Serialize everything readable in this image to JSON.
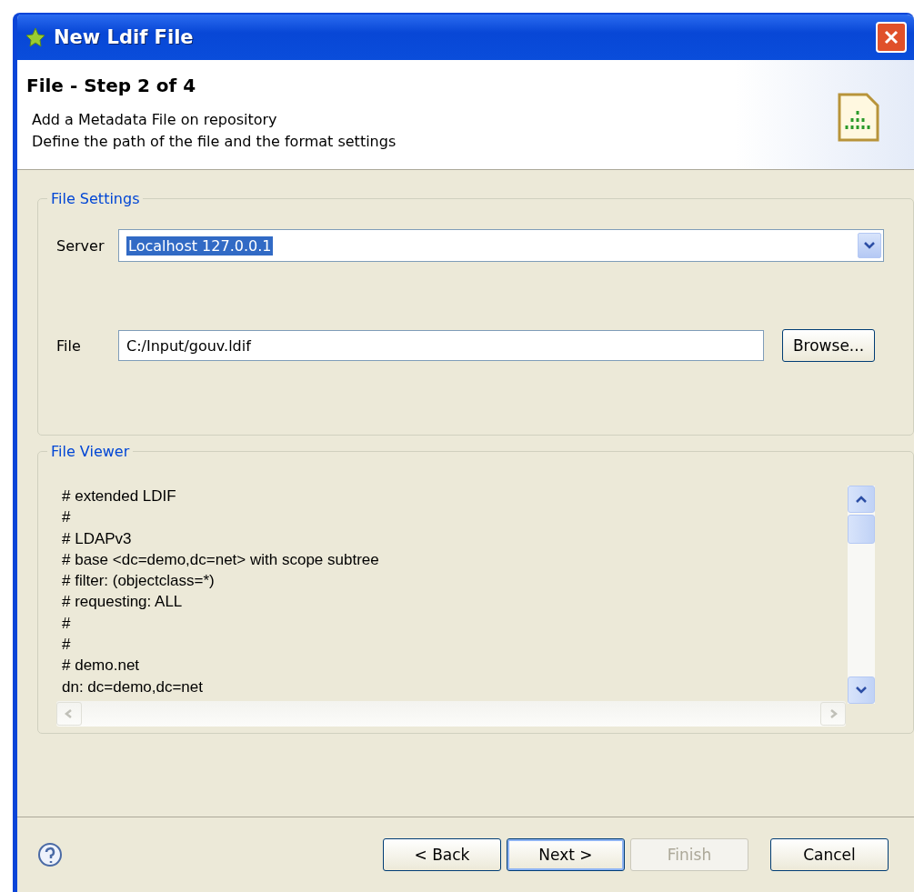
{
  "window": {
    "title": "New Ldif File"
  },
  "header": {
    "title": "File - Step 2 of 4",
    "lines": [
      "Add a Metadata File on repository",
      "Define the path of the file and the format settings"
    ]
  },
  "file_settings": {
    "legend": "File Settings",
    "server_label": "Server",
    "server_value": "Localhost 127.0.0.1",
    "file_label": "File",
    "file_value": "C:/Input/gouv.ldif",
    "browse": "Browse..."
  },
  "file_viewer": {
    "legend": "File Viewer",
    "lines": [
      "# extended LDIF",
      "#",
      "# LDAPv3",
      "# base <dc=demo,dc=net> with scope subtree",
      "# filter: (objectclass=*)",
      "# requesting: ALL",
      "#",
      "#",
      "# demo.net",
      "dn: dc=demo,dc=net"
    ]
  },
  "buttons": [
    {
      "label": "< Back",
      "disabled": false,
      "selected": false
    },
    {
      "label": "Next >",
      "disabled": false,
      "selected": true
    },
    {
      "label": "Finish",
      "disabled": true,
      "selected": false
    },
    {
      "label": "Cancel",
      "disabled": false,
      "selected": false
    }
  ]
}
